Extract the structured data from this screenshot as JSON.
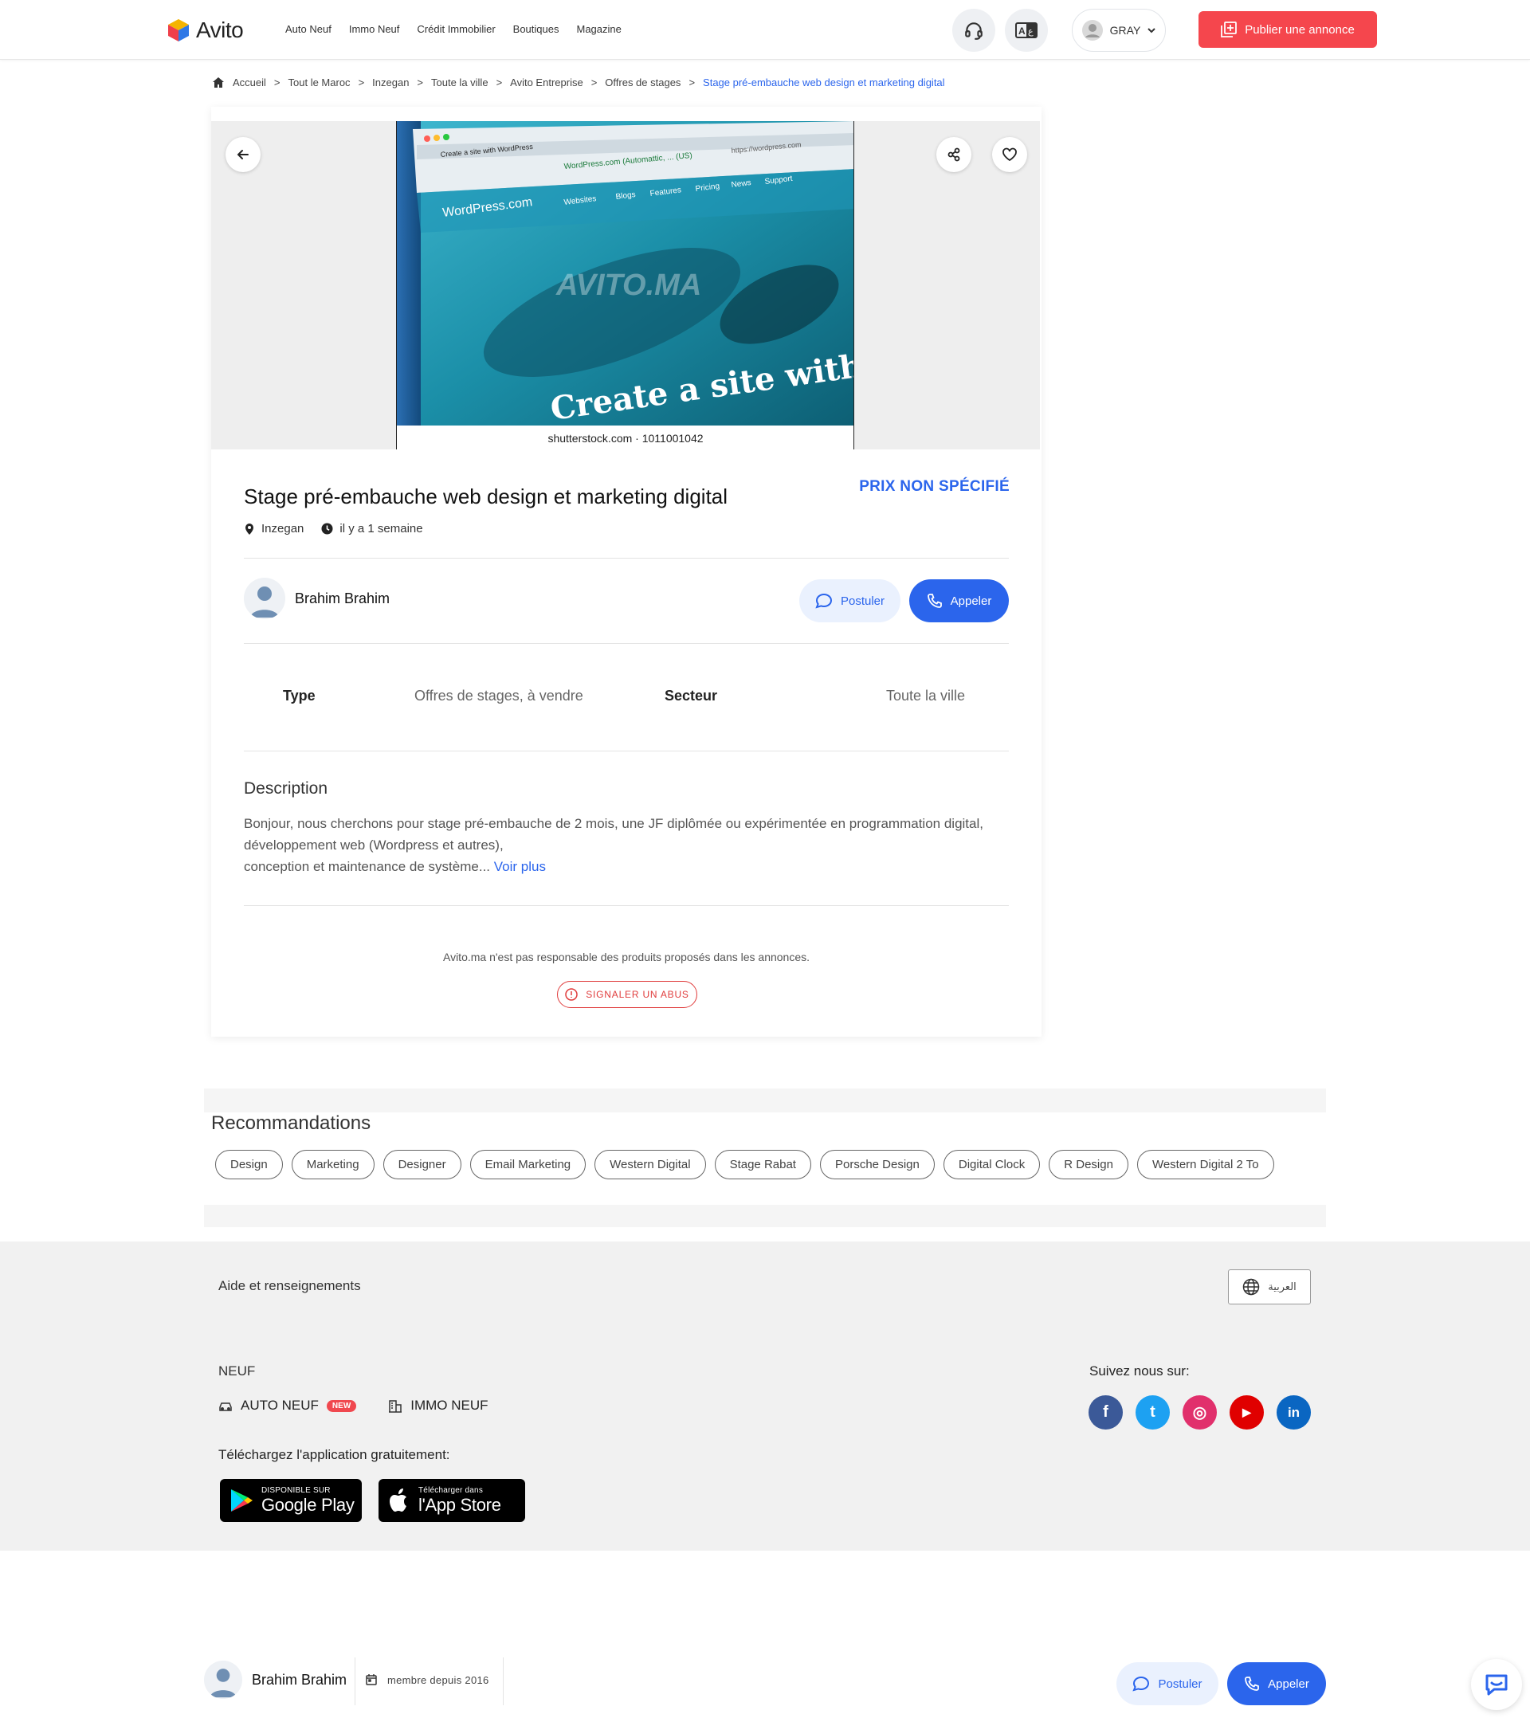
{
  "header": {
    "logo_text": "Avito",
    "nav": [
      "Auto Neuf",
      "Immo Neuf",
      "Crédit Immobilier",
      "Boutiques",
      "Magazine"
    ],
    "user_label": "GRAY",
    "publish_label": "Publier une annonce",
    "icons": [
      "headset-icon",
      "translate-icon",
      "user-icon",
      "chevron-down-icon",
      "add-listing-icon"
    ]
  },
  "breadcrumb": [
    "Accueil",
    "Tout le Maroc",
    "Inzegan",
    "Toute la ville",
    "Avito Entreprise",
    "Offres de stages",
    "Stage pré-embauche web design et marketing digital"
  ],
  "photo": {
    "browser_tab": "Create a site with WordPress",
    "address_site": "WordPress.com (Automattic, ...  (US)",
    "address_url": "https://wordpress.com",
    "brand": "WordPress.com",
    "menu": [
      "Websites",
      "Blogs",
      "Features",
      "Pricing",
      "News",
      "Support"
    ],
    "watermark": "AVITO.MA",
    "headline": "Create a site with W",
    "caption": "shutterstock.com · 1011001042"
  },
  "listing": {
    "title": "Stage pré-embauche web design et marketing digital",
    "price": "PRIX NON SPÉCIFIÉ",
    "location": "Inzegan",
    "posted": "il y a 1 semaine",
    "seller_name": "Brahim Brahim",
    "postuler_label": "Postuler",
    "appeler_label": "Appeler",
    "attributes": {
      "type_label": "Type",
      "type_value": "Offres de stages, à vendre",
      "secteur_label": "Secteur",
      "secteur_value": "Toute la ville"
    },
    "description_title": "Description",
    "description_lines": [
      "Bonjour, nous cherchons pour stage pré-embauche de 2 mois, une JF diplômée ou expérimentée en programmation digital,",
      "développement web (Wordpress et autres),",
      "conception et maintenance de système..."
    ],
    "voir_plus": "Voir plus",
    "disclaimer": "Avito.ma n'est pas responsable des produits proposés dans les annonces.",
    "report_label": "SIGNALER UN ABUS"
  },
  "recommendations": {
    "title": "Recommandations",
    "tags": [
      "Design",
      "Marketing",
      "Designer",
      "Email Marketing",
      "Western Digital",
      "Stage Rabat",
      "Porsche Design",
      "Digital Clock",
      "R Design",
      "Western Digital 2 To"
    ]
  },
  "footer": {
    "help": "Aide et renseignements",
    "language": "العربية",
    "neuf_title": "NEUF",
    "auto_neuf": "AUTO NEUF",
    "new_badge": "NEW",
    "immo_neuf": "IMMO NEUF",
    "app_title": "Téléchargez l'application gratuitement:",
    "google_small": "DISPONIBLE SUR",
    "google_big": "Google Play",
    "apple_small": "Télécharger dans",
    "apple_big": "l'App Store",
    "follow": "Suivez nous sur:",
    "socials": [
      {
        "name": "facebook",
        "glyph": "f",
        "color": "#3b5998"
      },
      {
        "name": "twitter",
        "glyph": "t",
        "color": "#1da1f2"
      },
      {
        "name": "instagram",
        "glyph": "◎",
        "color": "#e1306c"
      },
      {
        "name": "youtube",
        "glyph": "▶",
        "color": "#e00000"
      },
      {
        "name": "linkedin",
        "glyph": "in",
        "color": "#0a66c2"
      }
    ]
  },
  "sticky": {
    "seller_name": "Brahim Brahim",
    "member_since": "membre depuis 2016",
    "postuler_label": "Postuler",
    "appeler_label": "Appeler"
  },
  "colors": {
    "accent_blue": "#2b65ec",
    "publish_red": "#f5464d",
    "report_red": "#e03c3c"
  }
}
